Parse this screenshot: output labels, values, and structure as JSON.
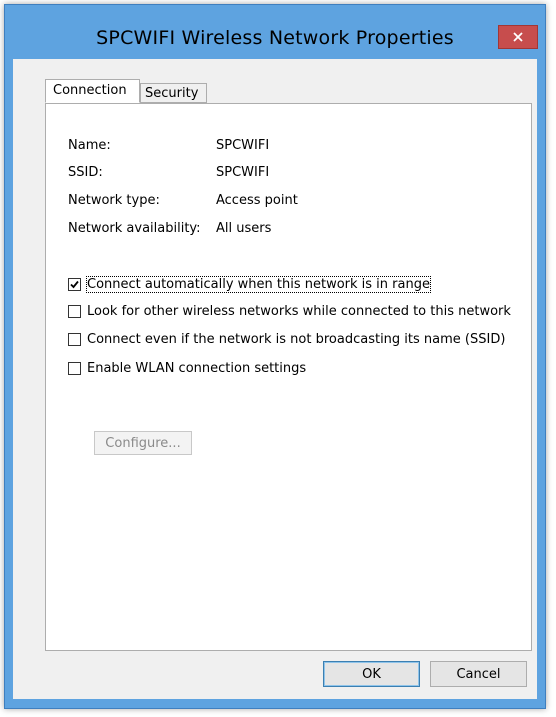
{
  "window": {
    "title": "SPCWIFI Wireless Network Properties",
    "close_glyph": "close-icon"
  },
  "tabs": [
    {
      "label": "Connection",
      "active": true
    },
    {
      "label": "Security",
      "active": false
    }
  ],
  "info": {
    "name_label": "Name:",
    "name_value": "SPCWIFI",
    "ssid_label": "SSID:",
    "ssid_value": "SPCWIFI",
    "type_label": "Network type:",
    "type_value": "Access point",
    "availability_label": "Network availability:",
    "availability_value": "All users"
  },
  "options": [
    {
      "label": "Connect automatically when this network is in range",
      "checked": true
    },
    {
      "label": "Look for other wireless networks while connected to this network",
      "checked": false
    },
    {
      "label": "Connect even if the network is not broadcasting its name (SSID)",
      "checked": false
    },
    {
      "label": "Enable WLAN connection settings",
      "checked": false
    }
  ],
  "buttons": {
    "configure": "Configure...",
    "ok": "OK",
    "cancel": "Cancel"
  },
  "colors": {
    "title_bar": "#5ea3e0",
    "close_button": "#c74d4d",
    "client_bg": "#f0f0f0"
  }
}
